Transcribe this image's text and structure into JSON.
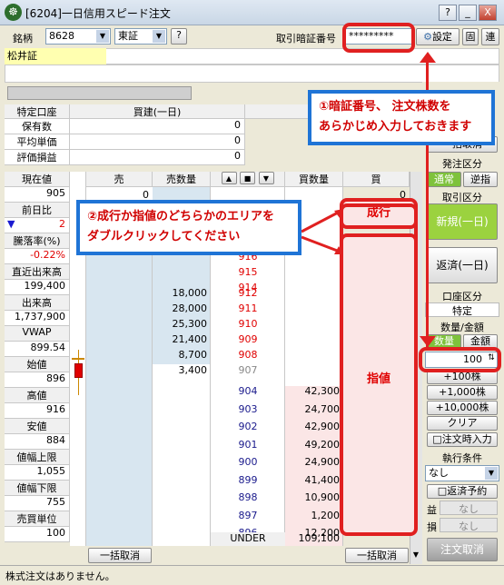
{
  "window": {
    "title": "[6204]一日信用スピード注文",
    "btn_help": "?",
    "btn_min": "_",
    "btn_max": "□",
    "btn_close": "X"
  },
  "toolbar": {
    "meigara_label": "銘柄",
    "code": "8628",
    "market": "東証",
    "help": "?",
    "pin_label": "取引暗証番号",
    "pin_value": "*********",
    "settings": "設定",
    "fix": "固",
    "link": "連"
  },
  "stock": {
    "name": "松井証"
  },
  "position": {
    "header_left": "特定口座",
    "header_mid": "買建(一日)",
    "rows": [
      {
        "label": "保有数",
        "value": "0"
      },
      {
        "label": "平均単価",
        "value": "0"
      },
      {
        "label": "評価損益",
        "value": "0"
      }
    ]
  },
  "info": [
    {
      "label": "現在値",
      "value": "905"
    },
    {
      "label": "前日比",
      "value": "2",
      "prefix": "▼"
    },
    {
      "label": "騰落率(%)",
      "value": "-0.22%"
    },
    {
      "label": "直近出来高",
      "value": "199,400"
    },
    {
      "label": "出来高",
      "value": "1,737,900"
    },
    {
      "label": "VWAP",
      "value": "899.54"
    },
    {
      "label": "始値",
      "value": "896"
    },
    {
      "label": "高値",
      "value": "916"
    },
    {
      "label": "安値",
      "value": "884"
    },
    {
      "label": "値幅上限",
      "value": "1,055"
    },
    {
      "label": "値幅下限",
      "value": "755"
    },
    {
      "label": "売買単位",
      "value": "100"
    }
  ],
  "board": {
    "sell": "売",
    "sell_qty": "売数量",
    "buy_qty": "買数量",
    "buy": "買",
    "sell_zero": "0",
    "buy_zero": "0",
    "market_label": "成行",
    "under": "UNDER",
    "under_qty": "109,100",
    "asks": [
      {
        "qty": "",
        "price": "916"
      },
      {
        "qty": "",
        "price": "915"
      },
      {
        "qty": "",
        "price": "914"
      },
      {
        "qty": "",
        "price": "913"
      },
      {
        "qty": "18,000",
        "price": "912"
      },
      {
        "qty": "28,000",
        "price": "911"
      },
      {
        "qty": "25,300",
        "price": "910"
      },
      {
        "qty": "21,400",
        "price": "909"
      },
      {
        "qty": "8,700",
        "price": "908"
      },
      {
        "qty": "3,400",
        "price": "907"
      }
    ],
    "bids": [
      {
        "price": "904",
        "qty": "42,300"
      },
      {
        "price": "903",
        "qty": "24,700"
      },
      {
        "price": "902",
        "qty": "42,900"
      },
      {
        "price": "901",
        "qty": "49,200"
      },
      {
        "price": "900",
        "qty": "24,900"
      },
      {
        "price": "899",
        "qty": "41,400"
      },
      {
        "price": "898",
        "qty": "10,900"
      },
      {
        "price": "897",
        "qty": "1,200"
      },
      {
        "price": "896",
        "qty": "12,200"
      }
    ],
    "cancel_all_sell": "一括取消",
    "cancel_all_buy": "一括取消"
  },
  "right": {
    "label_torikeshi": "一括取消",
    "label_hassou": "発注区分",
    "normal": "通常",
    "reverse": "逆指",
    "label_torihiki": "取引区分",
    "new_btn": "新規(一日)",
    "close_btn": "返済(一日)",
    "label_koza": "口座区分",
    "koza_value": "特定",
    "label_qty": "数量/金額",
    "qty_tab": "数量",
    "amount_tab": "金額",
    "qty_value": "100",
    "add_plus100": "+100株",
    "add_plus1000": "+1,000株",
    "add_plus10000": "+10,000株",
    "clear": "クリア",
    "auto_input": "注文時入力",
    "exec_label": "執行条件",
    "exec_value": "なし",
    "repay_reserve": "返済予約",
    "profit_label": "益",
    "profit_value": "なし",
    "loss_label": "損",
    "loss_value": "なし",
    "cancel_btn": "注文取消"
  },
  "status": {
    "text": "株式注文はありません。"
  },
  "annot": {
    "callout1_l1": "①暗証番号、 注文株数を",
    "callout1_l2": "あらかじめ入力しておきます",
    "callout2_l1": "②成行か指値のどちらかのエリアを",
    "callout2_l2": "ダブルクリックしてください",
    "nariyuki": "成行",
    "sashine": "指値"
  }
}
